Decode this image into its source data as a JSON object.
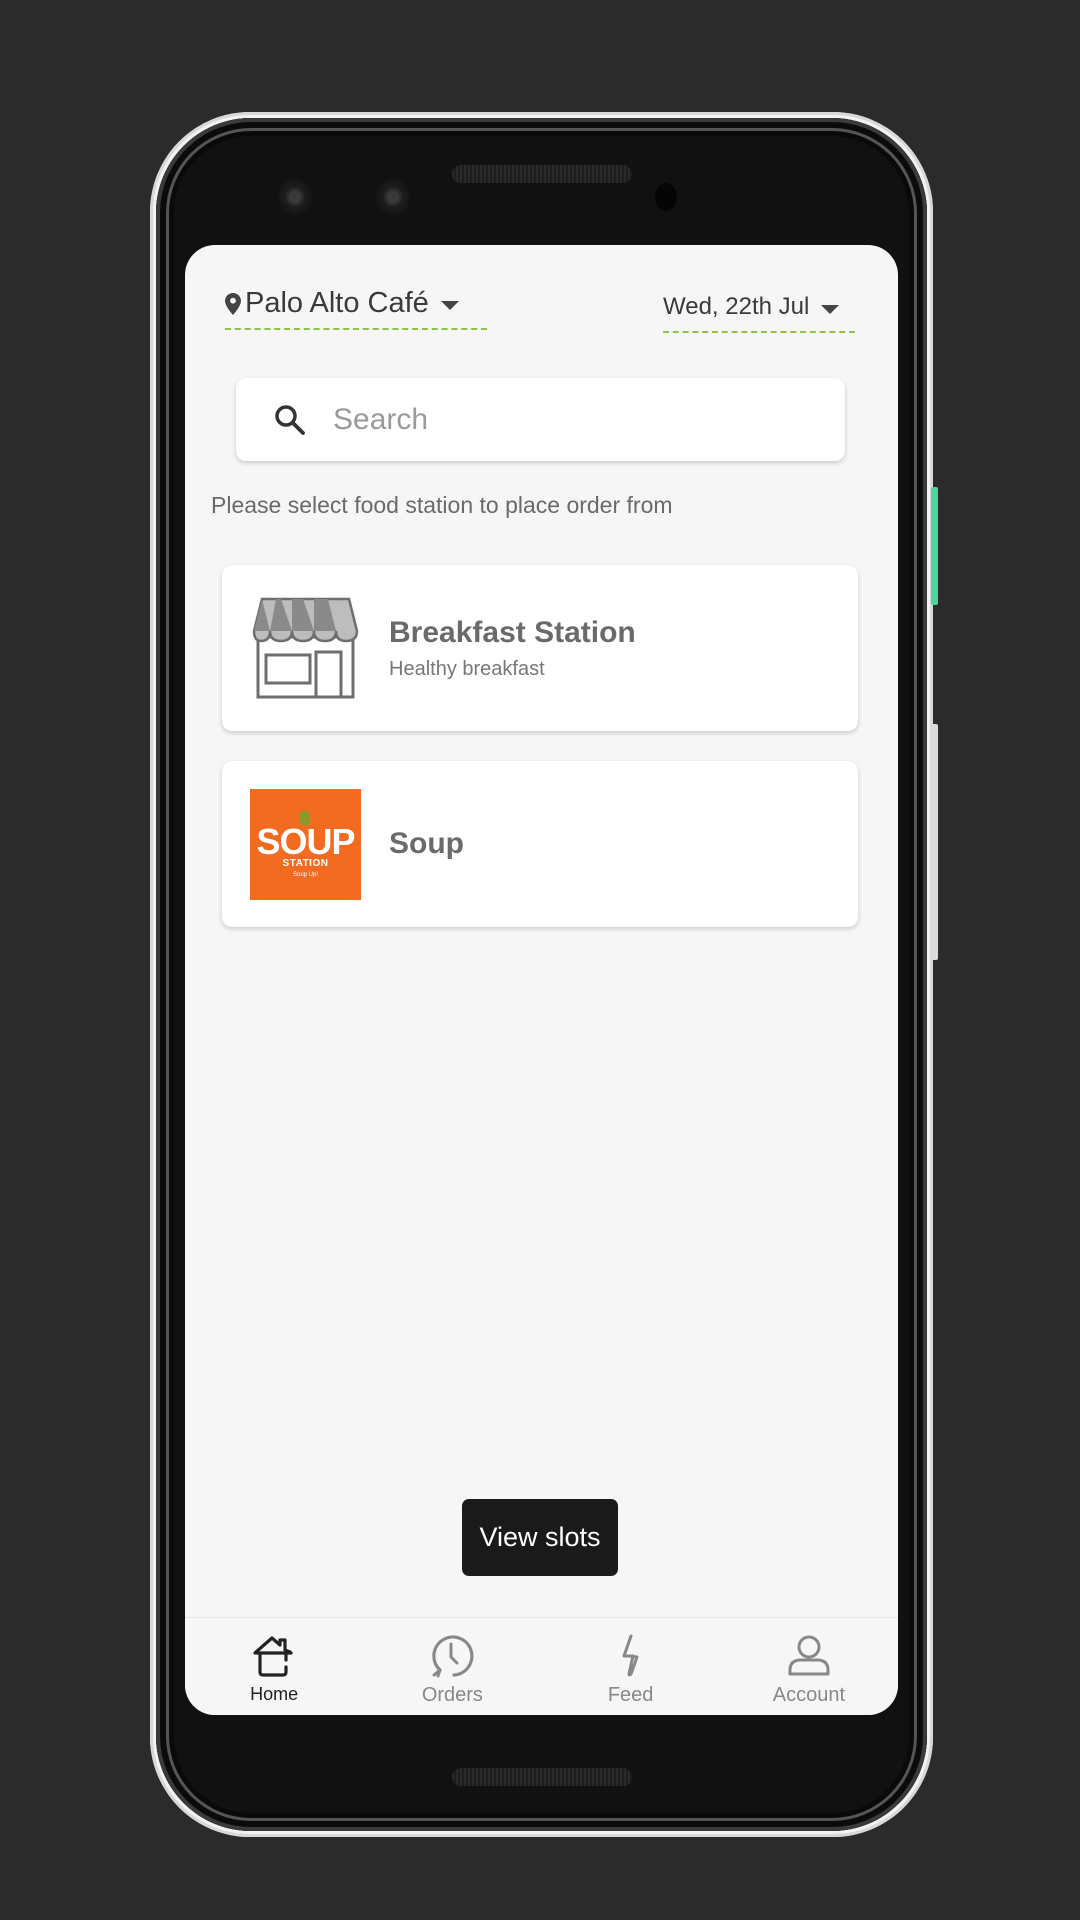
{
  "header": {
    "location": "Palo Alto Café",
    "date": "Wed, 22th Jul"
  },
  "search": {
    "placeholder": "Search",
    "value": ""
  },
  "instruction": "Please select food station to place order from",
  "stations": [
    {
      "name": "Breakfast Station",
      "subtitle": "Healthy breakfast",
      "icon": "storefront-icon"
    },
    {
      "name": "Soup",
      "subtitle": "",
      "icon": "soup-station-logo",
      "logo": {
        "word": "SOUP",
        "sub": "STATION",
        "tagline": "Soup Up!"
      }
    }
  ],
  "actions": {
    "view_slots": "View slots"
  },
  "nav": {
    "items": [
      {
        "label": "Home",
        "icon": "home-icon",
        "active": true
      },
      {
        "label": "Orders",
        "icon": "orders-clock-icon",
        "active": false
      },
      {
        "label": "Feed",
        "icon": "feed-bolt-icon",
        "active": false
      },
      {
        "label": "Account",
        "icon": "account-icon",
        "active": false
      }
    ]
  },
  "colors": {
    "accent_dashed": "#8bc34a",
    "soup_brand": "#f26b21",
    "button_bg": "#1a1a1a",
    "screen_bg": "#f6f6f6",
    "side_button": "#4fd59c"
  }
}
